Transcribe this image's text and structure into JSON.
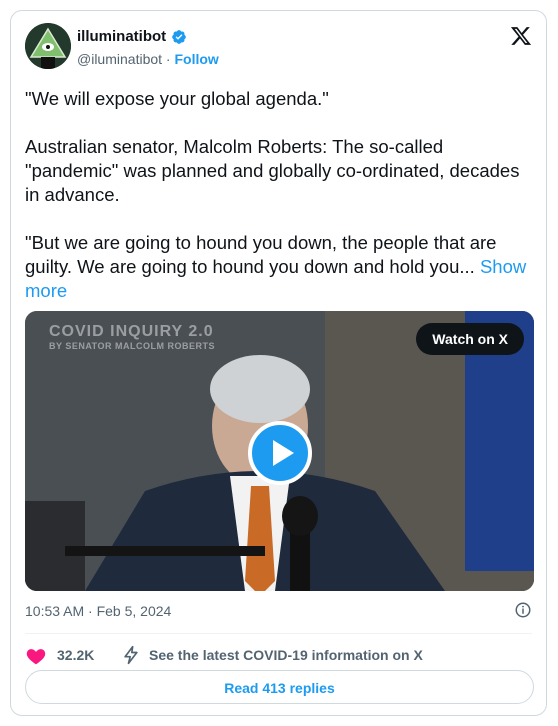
{
  "author": {
    "name": "illuminatibot",
    "handle": "@iluminatibot",
    "separator": "·",
    "follow_label": "Follow"
  },
  "tweet": {
    "paragraph1": "\"We will expose your global agenda.\"",
    "paragraph2": "Australian senator, Malcolm Roberts: The so-called \"pandemic\" was planned and globally co-ordinated, decades in advance.",
    "paragraph3": "\"But we are going to hound you down, the people that are guilty. We are going to hound you down and hold you...",
    "show_more": "Show more"
  },
  "video": {
    "overlay_title": "COVID INQUIRY 2.0",
    "overlay_subtitle": "BY SENATOR MALCOLM ROBERTS",
    "watch_label": "Watch on X"
  },
  "meta": {
    "timestamp": "10:53 AM · Feb 5, 2024"
  },
  "actions": {
    "likes": "32.2K",
    "covid_info": "See the latest COVID-19 information on X",
    "read_replies": "Read 413 replies"
  },
  "colors": {
    "accent": "#1d9bf0",
    "like": "#f91880",
    "text": "#0f1419",
    "muted": "#536471"
  }
}
